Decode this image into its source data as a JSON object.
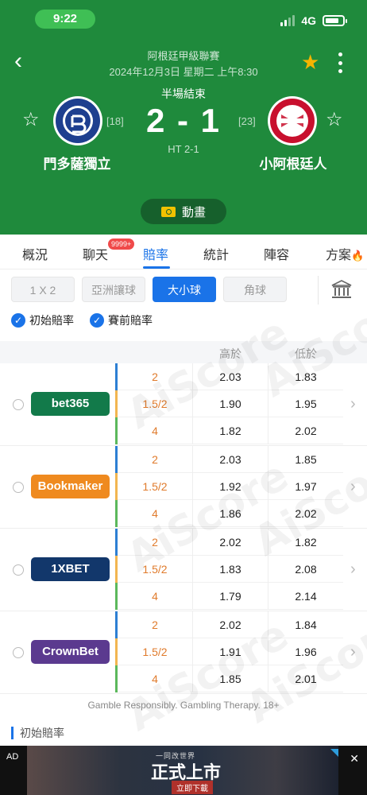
{
  "status_bar": {
    "time": "9:22",
    "network": "4G"
  },
  "match": {
    "league": "阿根廷甲級聯賽",
    "datetime": "2024年12月3日 星期二 上午8:30",
    "status": "半場結束",
    "score": "2 - 1",
    "halftime": "HT 2-1",
    "home": {
      "name": "門多薩獨立",
      "rank": "[18]"
    },
    "away": {
      "name": "小阿根廷人",
      "rank": "[23]"
    },
    "animation_label": "動畫"
  },
  "tabs": [
    {
      "label": "概況"
    },
    {
      "label": "聊天"
    },
    {
      "label": "賠率"
    },
    {
      "label": "統計"
    },
    {
      "label": "陣容"
    },
    {
      "label": "方案"
    }
  ],
  "chat_badge": "9999+",
  "markets": [
    "1 X 2",
    "亞洲讓球",
    "大小球",
    "角球"
  ],
  "active_market": "大小球",
  "filters": {
    "initial_odds": "初始賠率",
    "pre_match_odds": "賽前賠率"
  },
  "columns": {
    "over": "高於",
    "under": "低於"
  },
  "bookmakers": [
    {
      "name": "bet365",
      "color": "#127a4a",
      "rows": [
        {
          "line": "2",
          "over": "2.03",
          "under": "1.83"
        },
        {
          "line": "1.5/2",
          "over": "1.90",
          "under": "1.95"
        },
        {
          "line": "4",
          "over": "1.82",
          "under": "2.02"
        }
      ]
    },
    {
      "name": "Bookmaker",
      "color": "#ef8a1f",
      "rows": [
        {
          "line": "2",
          "over": "2.03",
          "under": "1.85"
        },
        {
          "line": "1.5/2",
          "over": "1.92",
          "under": "1.97"
        },
        {
          "line": "4",
          "over": "1.86",
          "under": "2.02"
        }
      ]
    },
    {
      "name": "1XBET",
      "color": "#12376b",
      "rows": [
        {
          "line": "2",
          "over": "2.02",
          "under": "1.82"
        },
        {
          "line": "1.5/2",
          "over": "1.83",
          "under": "2.08"
        },
        {
          "line": "4",
          "over": "1.79",
          "under": "2.14"
        }
      ]
    },
    {
      "name": "CrownBet",
      "color": "#5b3a8f",
      "rows": [
        {
          "line": "2",
          "over": "2.02",
          "under": "1.84"
        },
        {
          "line": "1.5/2",
          "over": "1.91",
          "under": "1.96"
        },
        {
          "line": "4",
          "over": "1.85",
          "under": "2.01"
        }
      ]
    }
  ],
  "row_bar_colors": [
    "#2d7fd3",
    "#f2b650",
    "#5cb85c"
  ],
  "disclaimer": "Gamble Responsibly. Gambling Therapy. 18+",
  "section_title": "初始賠率",
  "ad": {
    "label": "AD",
    "subtitle": "一同改世界",
    "title": "正式上市",
    "cta": "立即下載"
  },
  "colors": {
    "header_green": "#1f8a3c",
    "accent_blue": "#1a73e8",
    "star_gold": "#f5b400",
    "line_orange": "#e07b2c"
  }
}
